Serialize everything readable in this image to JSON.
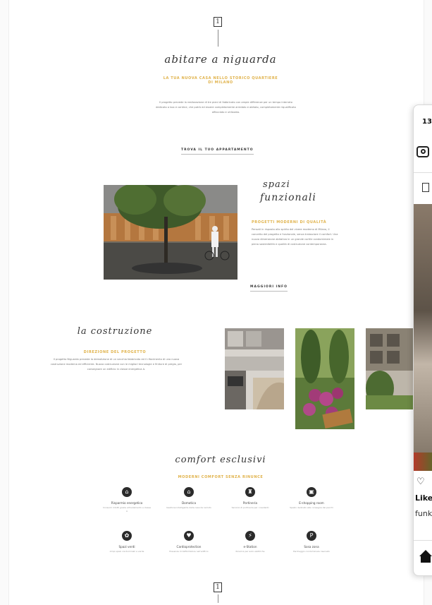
{
  "logo": {
    "mark": "1"
  },
  "hero": {
    "title": "abitare a niguarda",
    "subtitle": "LA TUA NUOVA CASA NELLO STORICO QUARTIERE DI MILANO",
    "body": "Il progetto prevede la realizzazione di tre piani di fabbricato con ampie differenze per un tempo interrato dedicato a box e cantine, che potrà ed essere completamente arredato e abitato, completamente riqualificato affacciato e utilizzato.",
    "cta": "TROVA IL TUO APPARTAMENTO"
  },
  "spazi": {
    "title_line1": "spazi",
    "title_line2": "funzionali",
    "subtitle": "PROGETTI MODERNI DI QUALITÀ",
    "body": "Pensati in risposta allo spirito del vivere moderno di Milano, il concetto del progetto e funzionale, senza tralasciare il comfort. Una nuova dimensione abitativa in un grande cortile condominiale in piena sostenibilità e qualità di costruzione contemporanea.",
    "cta": "MAGGIORI INFO"
  },
  "costruzione": {
    "title": "la costruzione",
    "subtitle": "DIREZIONE DEL PROGETTO",
    "body": "Il progetto Niguarda prevede la demolizione di un vecchio fabbricato ed il rifacimento di una nuova costruzione moderna ed efficiente. Nuova costruzione con le migliori tecnologie e finiture di pregio, per consegnare un edificio in classe energetica A."
  },
  "comfort": {
    "title": "comfort esclusivi",
    "subtitle": "MODERNI COMFORT SENZA RINUNCE",
    "items": [
      {
        "icon": "house-leaf-icon",
        "glyph": "⌂",
        "label": "Risparmio energetico",
        "desc": "Consumi ridotti grazie all'isolamento e classe A"
      },
      {
        "icon": "smart-home-icon",
        "glyph": "⌂",
        "label": "Domotica",
        "desc": "Gestione intelligente della casa da remoto"
      },
      {
        "icon": "concierge-icon",
        "glyph": "♜",
        "label": "Portineria",
        "desc": "Servizio di portineria per i residenti"
      },
      {
        "icon": "package-icon",
        "glyph": "▣",
        "label": "E-shopping room",
        "desc": "Spazio dedicato alla consegna dei pacchi"
      },
      {
        "icon": "green-space-icon",
        "glyph": "✿",
        "label": "Spazi verdi",
        "desc": "Ampi spazi condominiali a verde"
      },
      {
        "icon": "heart-protection-icon",
        "glyph": "♥",
        "label": "Cardioprotection",
        "desc": "Presenza di defibrillatore nell'edificio"
      },
      {
        "icon": "charging-station-icon",
        "glyph": "⚡",
        "label": "e-Station",
        "desc": "Ricarica per auto elettriche"
      },
      {
        "icon": "parking-icon",
        "glyph": "P",
        "label": "Sosa zona",
        "desc": "Parcheggio condominiale riservato"
      }
    ]
  },
  "phone_overlay": {
    "time": "13",
    "caption_line1": "Like",
    "caption_line2": "funk"
  },
  "colors": {
    "accent": "#e0b24a",
    "dark": "#2b2b2b"
  }
}
